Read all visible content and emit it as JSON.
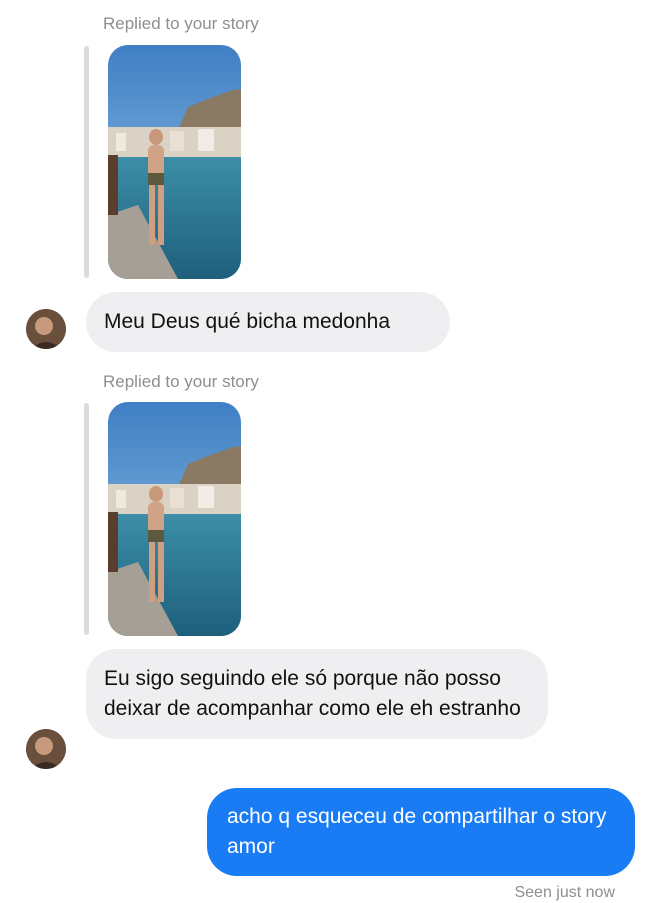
{
  "conversation": {
    "replies": [
      {
        "label": "Replied to your story"
      },
      {
        "label": "Replied to your story"
      }
    ],
    "incoming": [
      {
        "text": "Meu Deus qué bicha medonha"
      },
      {
        "text": "Eu sigo seguindo ele só porque não posso deixar de acompanhar como ele eh estranho"
      }
    ],
    "outgoing": [
      {
        "text": "acho q esqueceu de compartilhar o story amor"
      }
    ],
    "status": "Seen just now"
  },
  "colors": {
    "outgoing_bubble": "#1a7cf5",
    "incoming_bubble": "#efeff1",
    "meta_text": "#8e8e93"
  },
  "icons": {
    "story_image": "story-thumbnail",
    "avatar": "contact-avatar"
  }
}
